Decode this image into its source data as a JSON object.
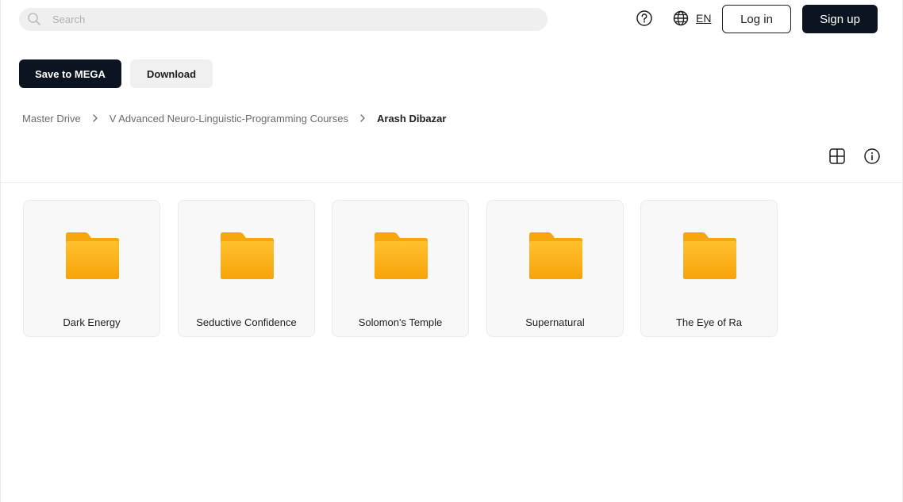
{
  "header": {
    "search_placeholder": "Search",
    "language": "EN",
    "login_label": "Log in",
    "signup_label": "Sign up"
  },
  "toolbar": {
    "save_label": "Save to MEGA",
    "download_label": "Download"
  },
  "breadcrumb": {
    "items": [
      "Master Drive",
      "V Advanced Neuro-Linguistic-Programming Courses"
    ],
    "current": "Arash Dibazar"
  },
  "folders": [
    {
      "name": "Dark Energy"
    },
    {
      "name": "Seductive Confidence"
    },
    {
      "name": "Solomon's Temple"
    },
    {
      "name": "Supernatural"
    },
    {
      "name": "The Eye of Ra"
    }
  ],
  "colors": {
    "primary_dark": "#0b1420",
    "folder_top": "#ffc12e",
    "folder_bottom": "#f7a30a"
  },
  "icons": {
    "search": "search-icon",
    "help": "help-icon",
    "language": "globe-icon",
    "view_toggle": "grid-view-icon",
    "info": "info-icon",
    "folder": "folder-icon"
  }
}
